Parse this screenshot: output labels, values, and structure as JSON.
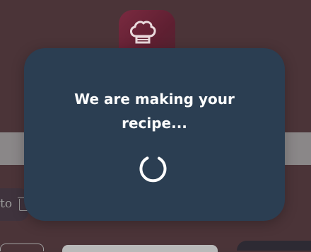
{
  "background": {
    "partial_text": "to"
  },
  "modal": {
    "title_line1": "We are making your",
    "title_line2": "recipe..."
  },
  "colors": {
    "overlay": "#4a3438",
    "modal": "#2b3e52",
    "text": "#ffffff",
    "accent": "#7a2a40"
  },
  "icons": {
    "logo": "chef-hat-icon",
    "spinner": "loading-spinner-icon",
    "trash": "trash-icon"
  }
}
